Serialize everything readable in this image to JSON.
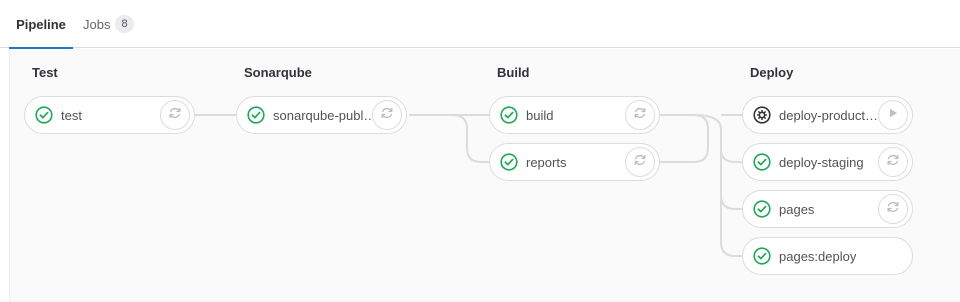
{
  "tabs": {
    "pipeline": "Pipeline",
    "jobs": "Jobs",
    "jobs_count": "8"
  },
  "colors": {
    "success": "#1aaa55",
    "manual": "#333238",
    "accent": "#1f75cb"
  },
  "stages": [
    {
      "title": "Test",
      "jobs": [
        {
          "name": "test",
          "status": "success",
          "icon": "status-success-icon",
          "action": "retry-icon"
        }
      ]
    },
    {
      "title": "Sonarqube",
      "jobs": [
        {
          "name": "sonarqube-publ…",
          "status": "success",
          "icon": "status-success-icon",
          "action": "retry-icon"
        }
      ]
    },
    {
      "title": "Build",
      "jobs": [
        {
          "name": "build",
          "status": "success",
          "icon": "status-success-icon",
          "action": "retry-icon"
        },
        {
          "name": "reports",
          "status": "success",
          "icon": "status-success-icon",
          "action": "retry-icon"
        }
      ]
    },
    {
      "title": "Deploy",
      "jobs": [
        {
          "name": "deploy-product…",
          "status": "manual",
          "icon": "status-manual-gear-icon",
          "action": "play-icon"
        },
        {
          "name": "deploy-staging",
          "status": "success",
          "icon": "status-success-icon",
          "action": "retry-icon"
        },
        {
          "name": "pages",
          "status": "success",
          "icon": "status-success-icon",
          "action": "retry-icon"
        },
        {
          "name": "pages:deploy",
          "status": "success",
          "icon": "status-success-icon",
          "action": ""
        }
      ]
    }
  ]
}
